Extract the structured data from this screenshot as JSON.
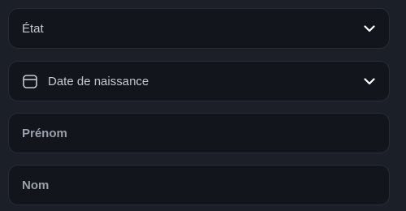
{
  "fields": {
    "state": {
      "label": "État",
      "icon": "chevron-down-icon"
    },
    "birthdate": {
      "label": "Date de naissance",
      "icon": "calendar-icon",
      "trailing_icon": "chevron-down-icon"
    },
    "first_name": {
      "placeholder": "Prénom"
    },
    "last_name": {
      "placeholder": "Nom"
    }
  },
  "colors": {
    "background": "#1b1f27",
    "field_background": "#12161c",
    "field_border": "#262b35",
    "label_text": "#c5c9d2",
    "placeholder_text": "#9aa0ab",
    "icon": "#ffffff"
  }
}
